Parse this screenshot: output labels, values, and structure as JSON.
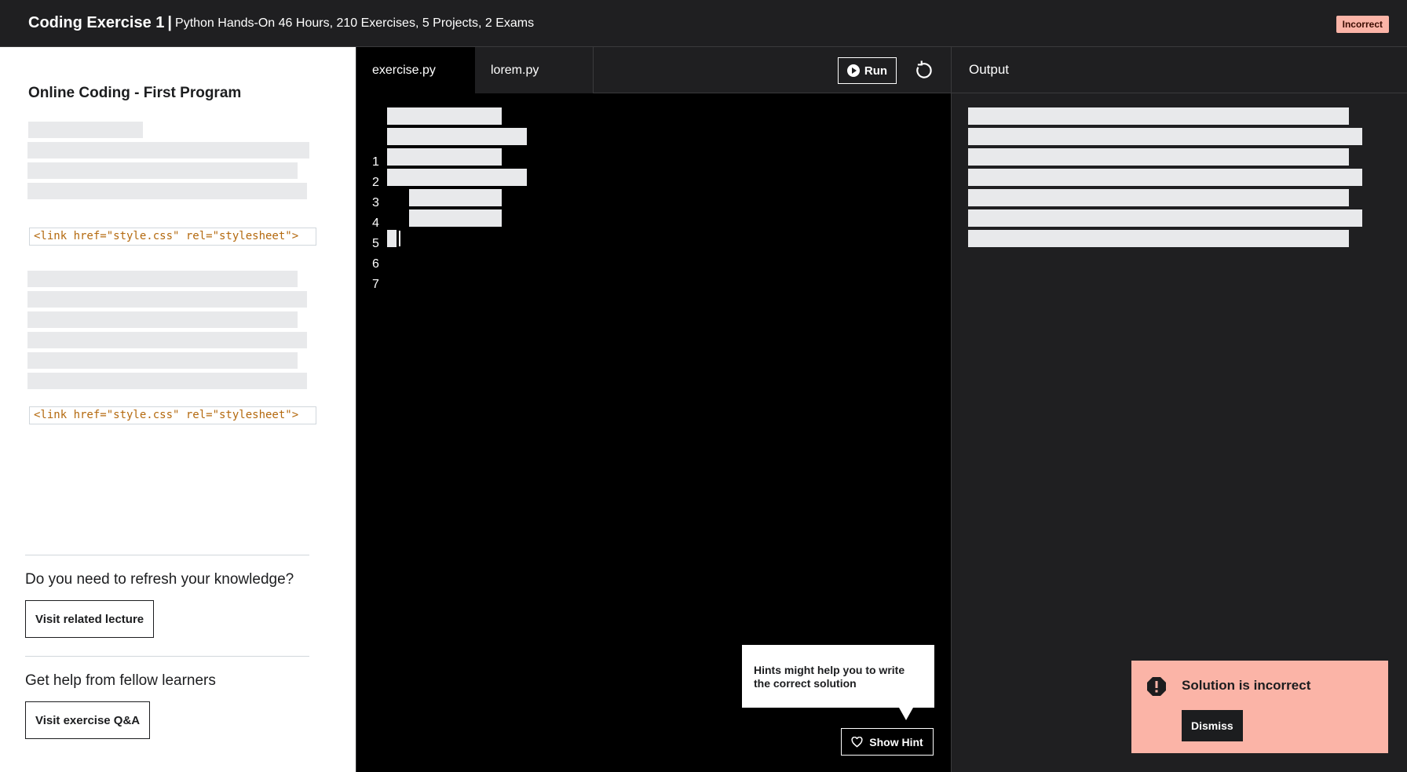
{
  "header": {
    "title": "Coding Exercise 1",
    "separator": "|",
    "subtitle": "Python Hands-On 46 Hours, 210 Exercises, 5 Projects, 2 Exams",
    "status_badge": "Incorrect"
  },
  "instructions": {
    "title": "Online Coding - First Program",
    "code_snippet_1": "<link href=\"style.css\" rel=\"stylesheet\">",
    "code_snippet_2": "<link href=\"style.css\" rel=\"stylesheet\">",
    "refresh_question": "Do you need to refresh your knowledge?",
    "visit_lecture_label": "Visit related lecture",
    "help_question": "Get help from fellow learners",
    "visit_qa_label": "Visit exercise Q&A"
  },
  "editor": {
    "tabs": [
      {
        "label": "exercise.py",
        "active": true
      },
      {
        "label": "lorem.py",
        "active": false
      }
    ],
    "run_label": "Run",
    "line_numbers": [
      "1",
      "2",
      "3",
      "4",
      "5",
      "6",
      "7"
    ],
    "hint_tooltip": "Hints might help you to write the correct solution",
    "show_hint_label": "Show Hint"
  },
  "output": {
    "title": "Output"
  },
  "alert": {
    "message": "Solution is incorrect",
    "dismiss_label": "Dismiss"
  },
  "colors": {
    "background_dark": "#1f1f21",
    "editor_bg": "#000000",
    "error_bg": "#fbb4a7",
    "skeleton": "#e8e9eb"
  }
}
